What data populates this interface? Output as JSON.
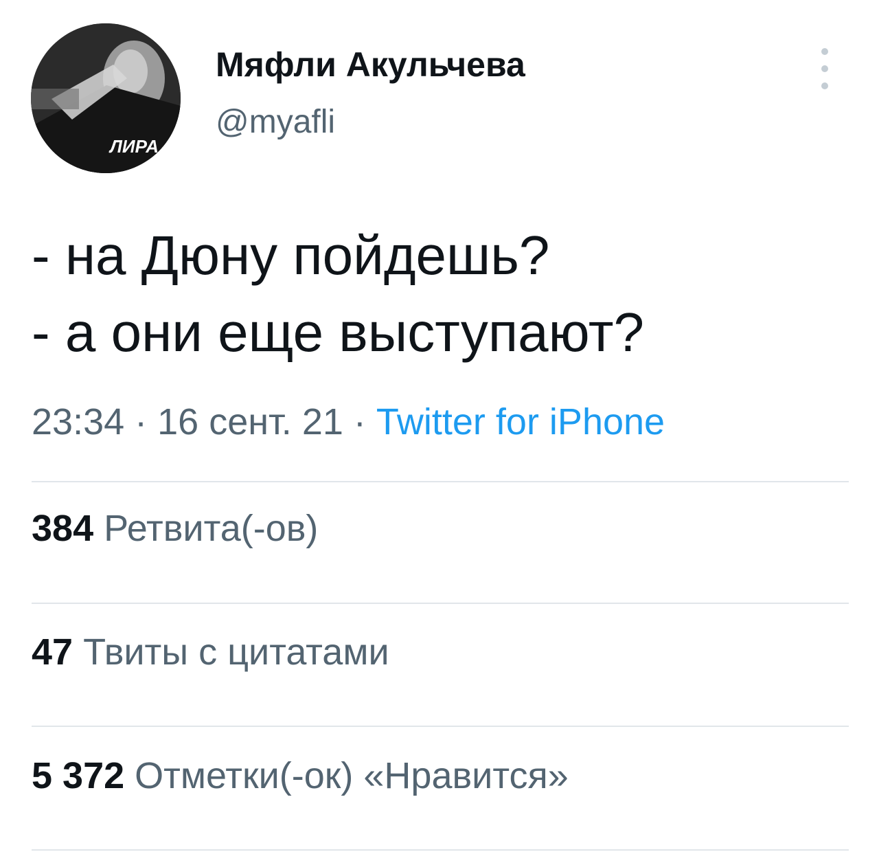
{
  "author": {
    "display_name": "Мяфли Акульчева",
    "handle": "@myafli",
    "avatar_overlay_text": "ЛИРА"
  },
  "more_icon": "more-vertical-icon",
  "tweet": {
    "lines": [
      "- на Дюну пойдешь?",
      "- а они еще выступают?"
    ]
  },
  "meta": {
    "time": "23:34",
    "separator_1": " · ",
    "date": "16 сент. 21",
    "separator_2": " · ",
    "source": "Twitter for iPhone"
  },
  "stats": {
    "retweets": {
      "count": "384",
      "label": "Ретвита(-ов)"
    },
    "quotes": {
      "count": "47",
      "label": "Твиты с цитатами"
    },
    "likes": {
      "count": "5 372",
      "label": "Отметки(-ок) «Нравится»"
    }
  },
  "colors": {
    "text_primary": "#0f1419",
    "text_secondary": "#536471",
    "link": "#1d9bf0",
    "divider": "#e1e6ea",
    "more_dots": "#c4cdd4"
  }
}
